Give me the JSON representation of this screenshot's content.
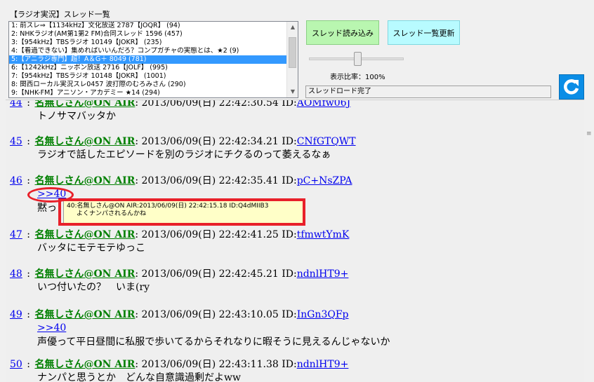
{
  "panel_title": "【ラジオ実況】スレッド一覧",
  "thread_list": [
    "1: 前スレ⇒【1134kHz】文化放送 2787【JOQR】 (94)",
    "2: NHKラジオ(AM第1第2 FM)合同スレッド 1596 (457)",
    "3:【954kHz】TBSラジオ 10149【JOKR】 (235)",
    "4:【看過できない】集めればいいんだろ？コンプガチャの実態とは、★2 (9)",
    "5:【アニラジ専門】超！A＆G＋ 8049 (781)",
    "6:【1242kHz】ニッポン放送 2716【JOLF】 (995)",
    "7:【954kHz】TBSラジオ 10148【JOKR】 (1001)",
    "8: 関西ローカル実況スレ0457 波打際のむろみさん (290)",
    "9:【NHK-FM】アニソン・アカデミー ★14 (294)"
  ],
  "selected_index": 4,
  "buttons": {
    "load_thread": "スレッド読み込み",
    "refresh_list": "スレッド一覧更新"
  },
  "zoom": {
    "label": "表示比率：100%",
    "value_percent": 100
  },
  "status": "スレッドロード完了",
  "posts": [
    {
      "number": "44",
      "name": "名無しさん@ON AIR",
      "date": "2013/06/09(日) 22:42:30.54",
      "id_prefix": "ID:",
      "id": "AOMfw06J",
      "body": "トノサマバッタか"
    },
    {
      "number": "45",
      "name": "名無しさん@ON AIR",
      "date": "2013/06/09(日) 22:42:34.21",
      "id_prefix": "ID:",
      "id": "CNfGTQWT",
      "body": "ラジオで話したエピソードを別のラジオにチクるのって萎えるなぁ"
    },
    {
      "number": "46",
      "name": "名無しさん@ON AIR",
      "date": "2013/06/09(日) 22:42:35.41",
      "id_prefix": "ID:",
      "id": "pC+NsZPA",
      "anchor": ">>40",
      "body": "黙っ"
    },
    {
      "number": "47",
      "name": "名無しさん@ON AIR",
      "date": "2013/06/09(日) 22:42:41.25",
      "id_prefix": "ID:",
      "id": "tfmwtYmK",
      "body": "バッタにモテモテゆっこ"
    },
    {
      "number": "48",
      "name": "名無しさん@ON AIR",
      "date": "2013/06/09(日) 22:42:45.21",
      "id_prefix": "ID:",
      "id": "ndnlHT9+",
      "body": "いつ付いたの？　いま(ry"
    },
    {
      "number": "49",
      "name": "名無しさん@ON AIR",
      "date": "2013/06/09(日) 22:43:10.05",
      "id_prefix": "ID:",
      "id": "InGn3QFp",
      "anchor": ">>40",
      "body": "声優って平日昼間に私服で歩いてるからそれなりに暇そうに見えるんじゃないか"
    },
    {
      "number": "50",
      "name": "名無しさん@ON AIR",
      "date": "2013/06/09(日) 22:43:11.38",
      "id_prefix": "ID:",
      "id": "ndnlHT9+",
      "body": "ナンパと思うとか　どんな自意識過剰だよww"
    }
  ],
  "tooltip": {
    "header": "40:名無しさん@ON AIR:2013/06/09(日) 22:42:15.18 ID:Q4dMIIB3",
    "body": "よくナンパされるんかね"
  },
  "colors": {
    "highlight": "#e8202a",
    "name_green": "#008000",
    "link_blue": "#0000ee"
  }
}
